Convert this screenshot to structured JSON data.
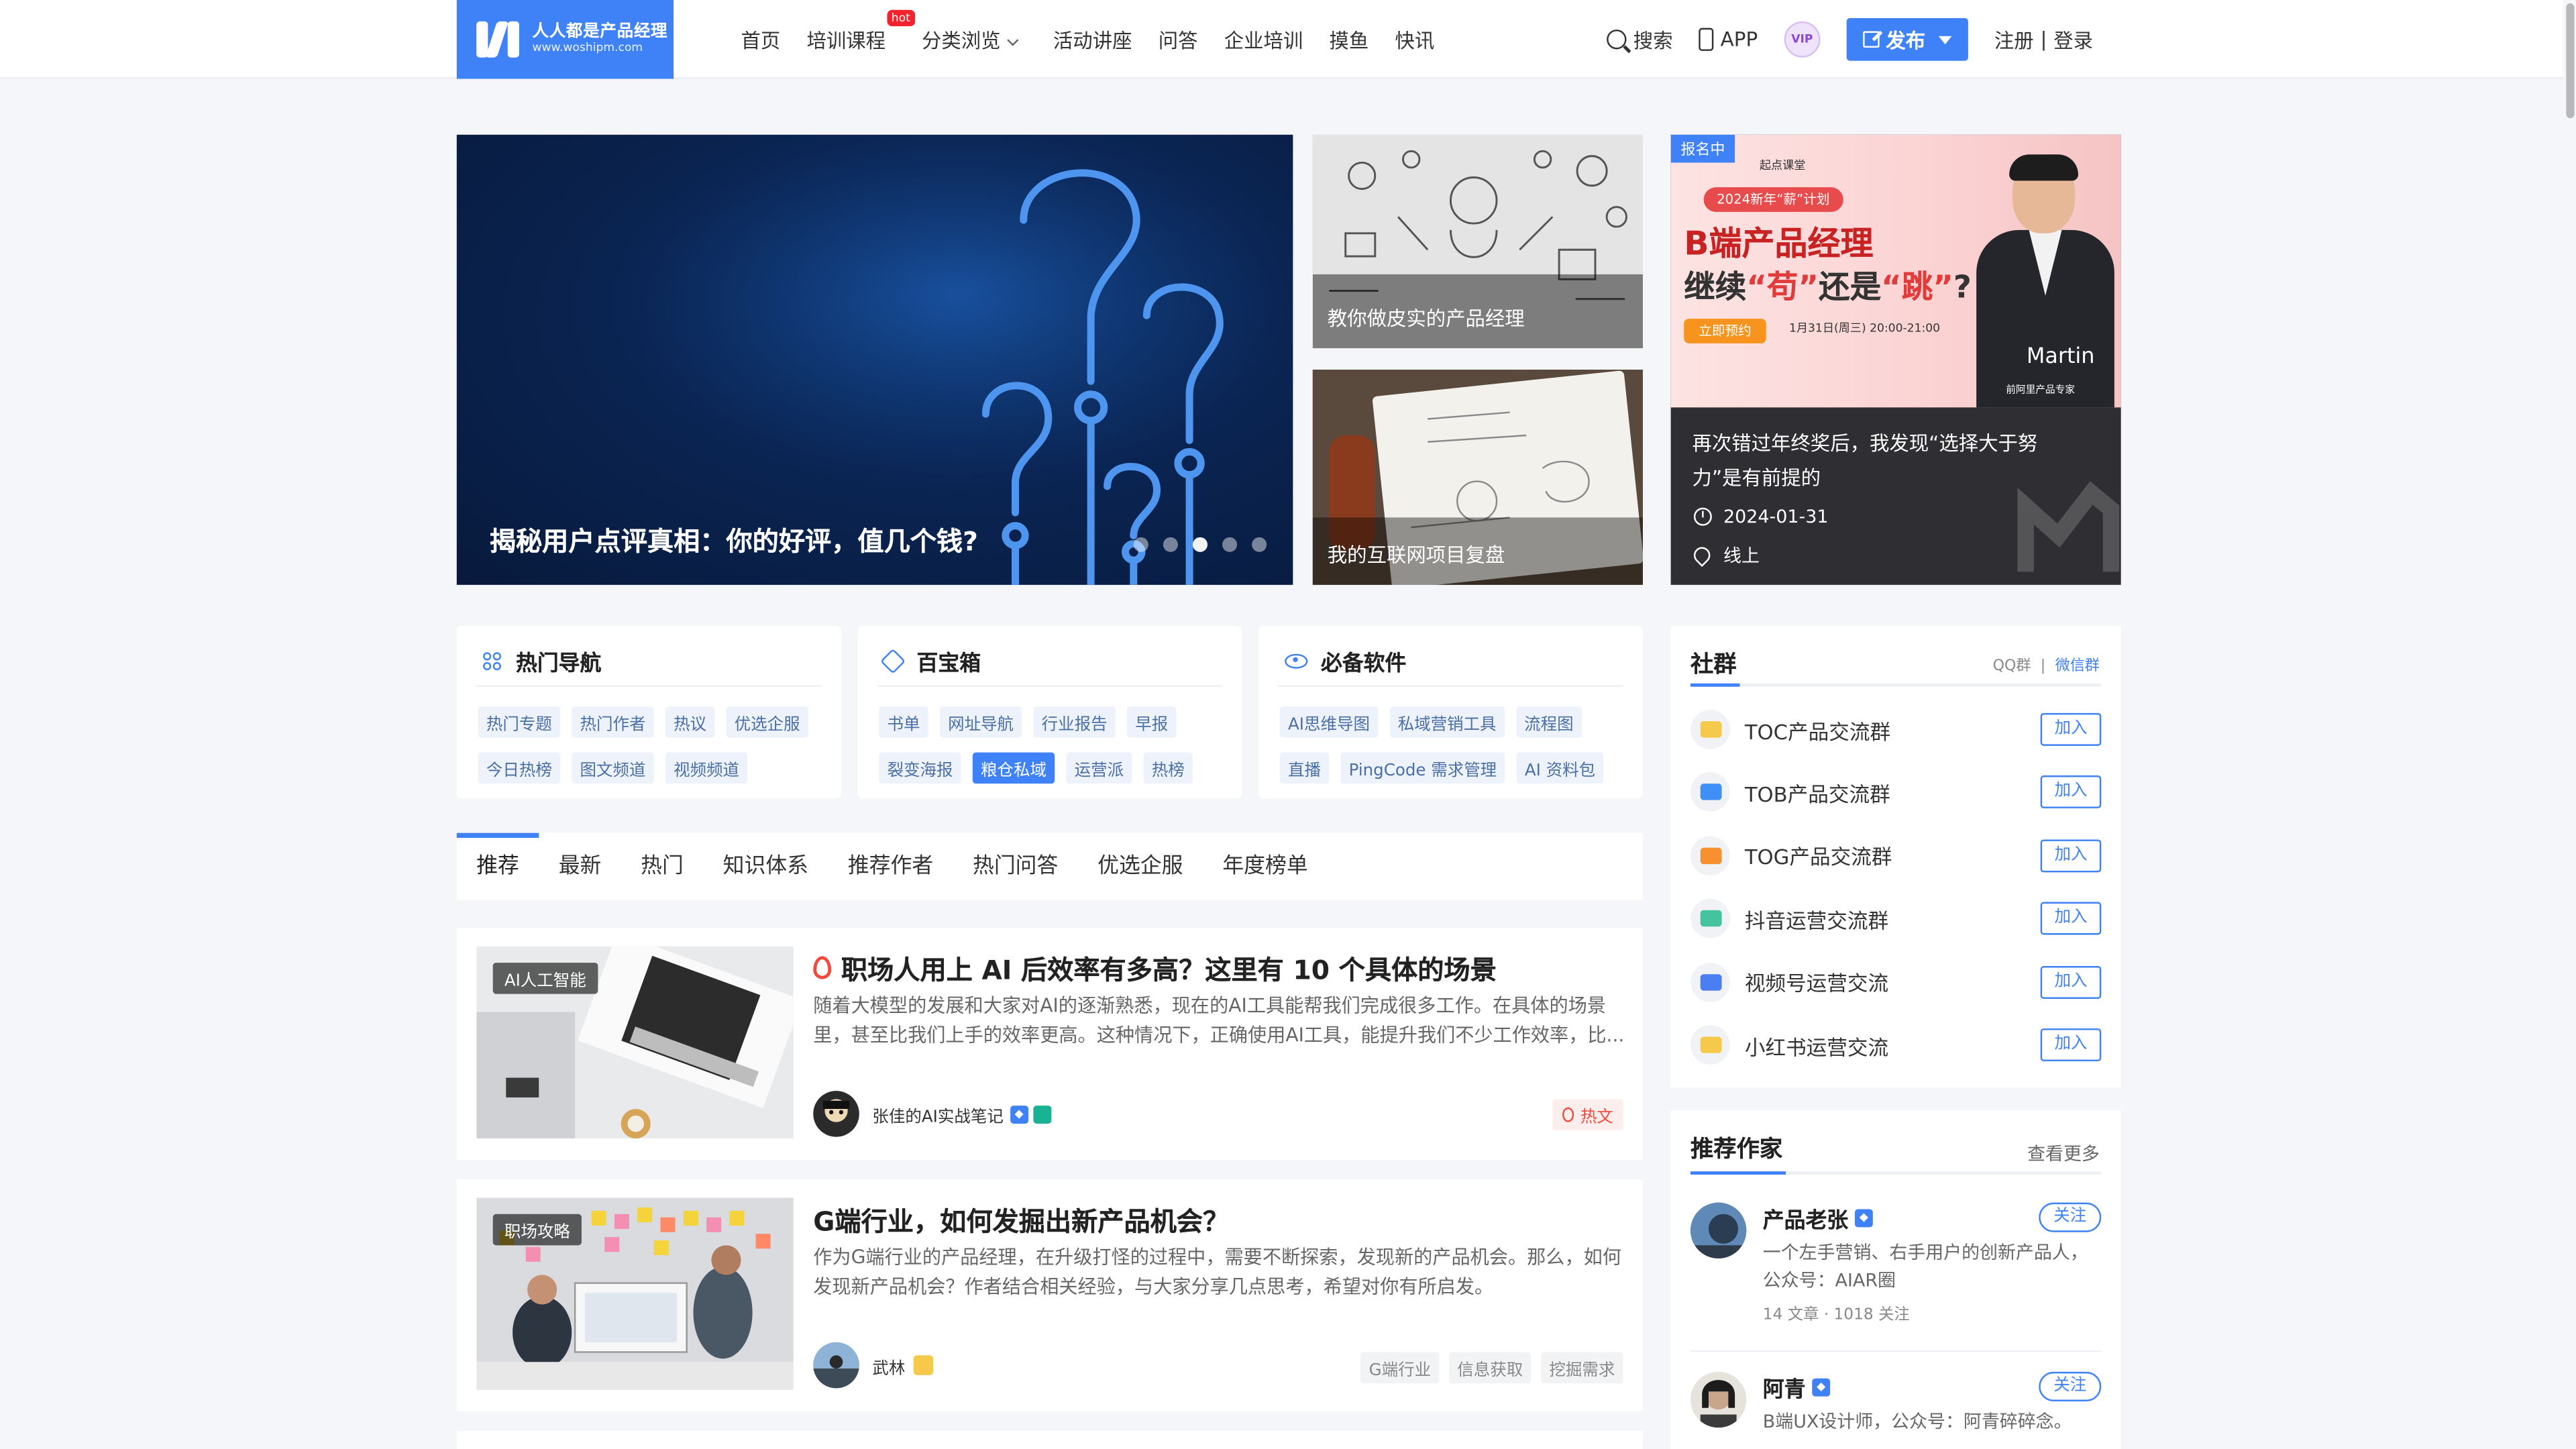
{
  "header": {
    "logo": {
      "name": "人人都是产品经理",
      "url_text": "www.woshipm.com"
    },
    "nav": [
      {
        "label": "首页"
      },
      {
        "label": "培训课程",
        "badge": "hot"
      },
      {
        "label": "分类浏览",
        "dropdown": true
      },
      {
        "label": "活动讲座"
      },
      {
        "label": "问答"
      },
      {
        "label": "企业培训"
      },
      {
        "label": "摸鱼"
      },
      {
        "label": "快讯"
      }
    ],
    "search_label": "搜索",
    "app_label": "APP",
    "vip_label": "VIP",
    "publish_label": "发布",
    "register_label": "注册",
    "login_label": "登录",
    "separator": "|"
  },
  "hero": {
    "main_title": "揭秘用户点评真相：你的好评，值几个钱?",
    "slide_count": 5,
    "active_slide": 3,
    "side_cards": [
      {
        "title": "教你做皮实的产品经理"
      },
      {
        "title": "我的互联网项目复盘"
      }
    ],
    "event": {
      "status": "报名中",
      "brand": "起点课堂",
      "pill": "2024新年“薪”计划",
      "headline_1": "B端产品经理",
      "headline_2_pre": "继续",
      "headline_2_stay": "“苟”",
      "headline_2_mid": "还是",
      "headline_2_jump": "“跳”",
      "headline_2_end": "?",
      "book_label": "立即预约",
      "time_text": "1月31日(周三) 20:00-21:00",
      "speaker_name": "Martin",
      "speaker_role": "前阿里产品专家",
      "title": "再次错过年终奖后，我发现“选择大于努力”是有前提的",
      "date": "2024-01-31",
      "location": "线上"
    }
  },
  "nav_cards": [
    {
      "title": "热门导航",
      "icon": "grid-icon",
      "tags": [
        "热门专题",
        "热门作者",
        "热议",
        "优选企服",
        "今日热榜",
        "图文频道",
        "视频频道"
      ]
    },
    {
      "title": "百宝箱",
      "icon": "tag-icon",
      "tags": [
        "书单",
        "网址导航",
        "行业报告",
        "早报",
        "裂变海报",
        "粮仓私域",
        "运营派",
        "热榜"
      ],
      "active": "粮仓私域"
    },
    {
      "title": "必备软件",
      "icon": "eye-icon",
      "tags": [
        "AI思维导图",
        "私域营销工具",
        "流程图",
        "直播",
        "PingCode 需求管理",
        "AI 资料包"
      ]
    }
  ],
  "tabs": [
    "推荐",
    "最新",
    "热门",
    "知识体系",
    "推荐作者",
    "热门问答",
    "优选企服",
    "年度榜单"
  ],
  "articles": [
    {
      "category": "AI人工智能",
      "title": "职场人用上 AI 后效率有多高？这里有 10 个具体的场景",
      "hot_icon": true,
      "desc": "随着大模型的发展和大家对AI的逐渐熟悉，现在的AI工具能帮我们完成很多工作。在具体的场景里，甚至比我们上手的效率更高。这种情况下，正确使用AI工具，能提升我们不少工作效率，比...",
      "author": "张佳的AI实战笔记",
      "hot_label": "热文"
    },
    {
      "category": "职场攻略",
      "title": "G端行业，如何发掘出新产品机会？",
      "desc": "作为G端行业的产品经理，在升级打怪的过程中，需要不断探索，发现新的产品机会。那么，如何发现新产品机会？作者结合相关经验，与大家分享几点思考，希望对你有所启发。",
      "author": "武林",
      "keywords": [
        "G端行业",
        "信息获取",
        "挖掘需求"
      ]
    }
  ],
  "community": {
    "title": "社群",
    "switch_qq": "QQ群",
    "switch_wechat": "微信群",
    "join_label": "加入",
    "groups": [
      {
        "name": "TOC产品交流群",
        "color": "#f6c94a"
      },
      {
        "name": "TOB产品交流群",
        "color": "#3f8ff7"
      },
      {
        "name": "TOG产品交流群",
        "color": "#f7902e"
      },
      {
        "name": "抖音运营交流群",
        "color": "#43c39e"
      },
      {
        "name": "视频号运营交流",
        "color": "#4c7ef3"
      },
      {
        "name": "小红书运营交流",
        "color": "#f6c94a"
      }
    ]
  },
  "writers": {
    "title": "推荐作家",
    "more_label": "查看更多",
    "follow_label": "关注",
    "list": [
      {
        "name": "产品老张",
        "desc": "一个左手营销、右手用户的创新产品人，公众号：AIAR圈",
        "stats": "14 文章 · 1018 关注"
      },
      {
        "name": "阿青",
        "desc": "B端UX设计师，公众号：阿青碎碎念。",
        "stats": ""
      }
    ]
  },
  "colors": {
    "brand": "#3f82f7",
    "hot": "#f24a3c",
    "page_bg": "#f5f6f9"
  }
}
